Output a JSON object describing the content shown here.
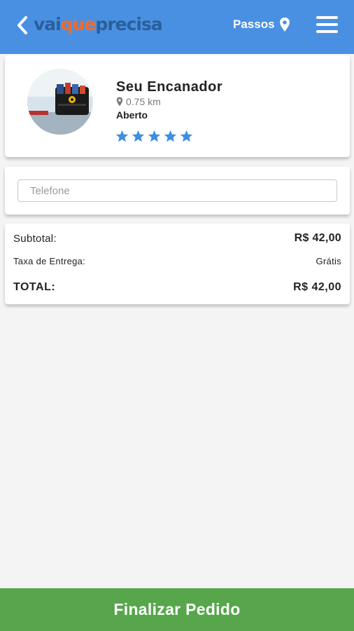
{
  "header": {
    "logo_part1": "vai",
    "logo_part2": "que",
    "logo_part3": "precisa",
    "location_label": "Passos",
    "colors": {
      "background": "#4a90e2",
      "logo_blue": "#2a5f9b",
      "logo_orange": "#ef6a2c"
    },
    "icons": {
      "back": "chevron-left-icon",
      "location": "map-pin-icon",
      "menu": "hamburger-menu-icon"
    }
  },
  "store": {
    "name": "Seu Encanador",
    "distance": "0.75 km",
    "status": "Aberto",
    "rating": 5,
    "rating_max": 5,
    "star_color": "#3f8ee0"
  },
  "phone": {
    "placeholder": "Telefone",
    "value": ""
  },
  "totals": {
    "subtotal_label": "Subtotal:",
    "subtotal_value": "R$ 42,00",
    "delivery_label": "Taxa de Entrega:",
    "delivery_value": "Grátis",
    "total_label": "TOTAL:",
    "total_value": "R$ 42,00"
  },
  "footer": {
    "finalize_label": "Finalizar Pedido",
    "color": "#57a64c"
  }
}
